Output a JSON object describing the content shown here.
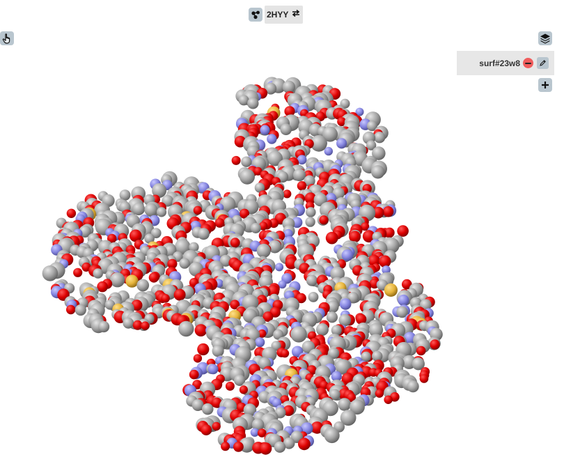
{
  "molecule": {
    "title": "2HYY",
    "structure_icon": "molecule-icon",
    "swap_icon": "swap-arrows-icon"
  },
  "toolbar": {
    "pointer_icon": "hand-pointer-icon",
    "layers_icon": "layers-icon",
    "add_icon": "plus-icon"
  },
  "layers": {
    "items": [
      {
        "name": "surf#23w8",
        "remove_icon": "minus-circle-icon",
        "edit_icon": "pencil-icon"
      }
    ]
  },
  "colors": {
    "carbon": "#a8a8a8",
    "oxygen": "#e10000",
    "nitrogen": "#8a8ae6",
    "sulfur": "#e6b43c",
    "button_bg": "#b9c6cf",
    "remove": "#f05d5d"
  }
}
